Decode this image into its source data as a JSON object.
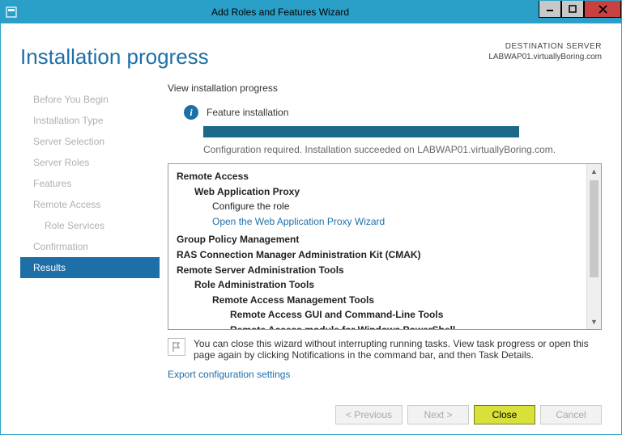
{
  "window": {
    "title": "Add Roles and Features Wizard"
  },
  "header": {
    "page_title": "Installation progress",
    "dest_label": "DESTINATION SERVER",
    "dest_value": "LABWAP01.virtuallyBoring.com"
  },
  "sidebar": {
    "items": [
      {
        "label": "Before You Begin",
        "active": false,
        "sub": false
      },
      {
        "label": "Installation Type",
        "active": false,
        "sub": false
      },
      {
        "label": "Server Selection",
        "active": false,
        "sub": false
      },
      {
        "label": "Server Roles",
        "active": false,
        "sub": false
      },
      {
        "label": "Features",
        "active": false,
        "sub": false
      },
      {
        "label": "Remote Access",
        "active": false,
        "sub": false
      },
      {
        "label": "Role Services",
        "active": false,
        "sub": true
      },
      {
        "label": "Confirmation",
        "active": false,
        "sub": false
      },
      {
        "label": "Results",
        "active": true,
        "sub": false
      }
    ]
  },
  "main": {
    "heading": "View installation progress",
    "status_title": "Feature installation",
    "status_sub": "Configuration required. Installation succeeded on LABWAP01.virtuallyBoring.com.",
    "results": {
      "line0": "Remote Access",
      "line1": "Web Application Proxy",
      "line2": "Configure the role",
      "link": "Open the Web Application Proxy Wizard",
      "line3": "Group Policy Management",
      "line4": "RAS Connection Manager Administration Kit (CMAK)",
      "line5": "Remote Server Administration Tools",
      "line6": "Role Administration Tools",
      "line7": "Remote Access Management Tools",
      "line8": "Remote Access GUI and Command-Line Tools",
      "line9": "Remote Access module for Windows PowerShell"
    },
    "note": "You can close this wizard without interrupting running tasks. View task progress or open this page again by clicking Notifications in the command bar, and then Task Details.",
    "export_link": "Export configuration settings"
  },
  "footer": {
    "previous": "< Previous",
    "next": "Next >",
    "close": "Close",
    "cancel": "Cancel"
  }
}
